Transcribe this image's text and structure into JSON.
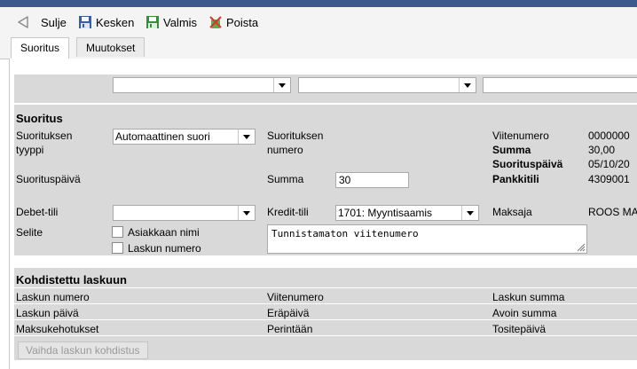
{
  "toolbar": {
    "close_label": "Sulje",
    "draft_label": "Kesken",
    "ready_label": "Valmis",
    "delete_label": "Poista"
  },
  "tabs": [
    {
      "label": "Suoritus",
      "active": true
    },
    {
      "label": "Muutokset",
      "active": false
    }
  ],
  "filters": [
    "",
    "",
    ""
  ],
  "payment": {
    "section_title": "Suoritus",
    "type_label_1": "Suorituksen",
    "type_label_2": "tyyppi",
    "type_value": "Automaattinen suori",
    "number_label_1": "Suorituksen",
    "number_label_2": "numero",
    "date_label": "Suorituspäivä",
    "sum_label": "Summa",
    "sum_value": "30",
    "debit_label": "Debet-tili",
    "debit_value": "",
    "credit_label": "Kredit-tili",
    "credit_value": "1701: Myyntisaamis",
    "payer_label": "Maksaja",
    "payer_value": "ROOS MA",
    "memo_label": "Selite",
    "opt_customer_name": "Asiakkaan nimi",
    "opt_invoice_number": "Laskun numero",
    "memo_text": "Tunnistamaton viitenumero"
  },
  "summary": {
    "reference_label": "Viitenumero",
    "reference_value": "0000000",
    "sum_label": "Summa",
    "sum_value": "30,00",
    "date_label": "Suorituspäivä",
    "date_value": "05/10/20",
    "bank_label": "Pankkitili",
    "bank_value": "4309001"
  },
  "invoice": {
    "section_title": "Kohdistettu laskuun",
    "number_label": "Laskun numero",
    "reference_label": "Viitenumero",
    "amount_label": "Laskun summa",
    "date_label": "Laskun päivä",
    "due_label": "Eräpäivä",
    "open_label": "Avoin summa",
    "reminders_label": "Maksukehotukset",
    "collection_label": "Perintään",
    "voucher_date_label": "Tositepäivä",
    "change_button": "Vaihda laskun kohdistus"
  },
  "colors": {
    "header_bar": "#3c5a8c",
    "content_bg": "#d9d9d9",
    "icon_blue": "#3a5f9e",
    "icon_green": "#3a8c3a",
    "delete_red": "#d23a2a"
  },
  "icons": {
    "close": "back-arrow-icon",
    "draft": "save-icon",
    "ready": "save-icon",
    "delete": "delete-icon"
  }
}
